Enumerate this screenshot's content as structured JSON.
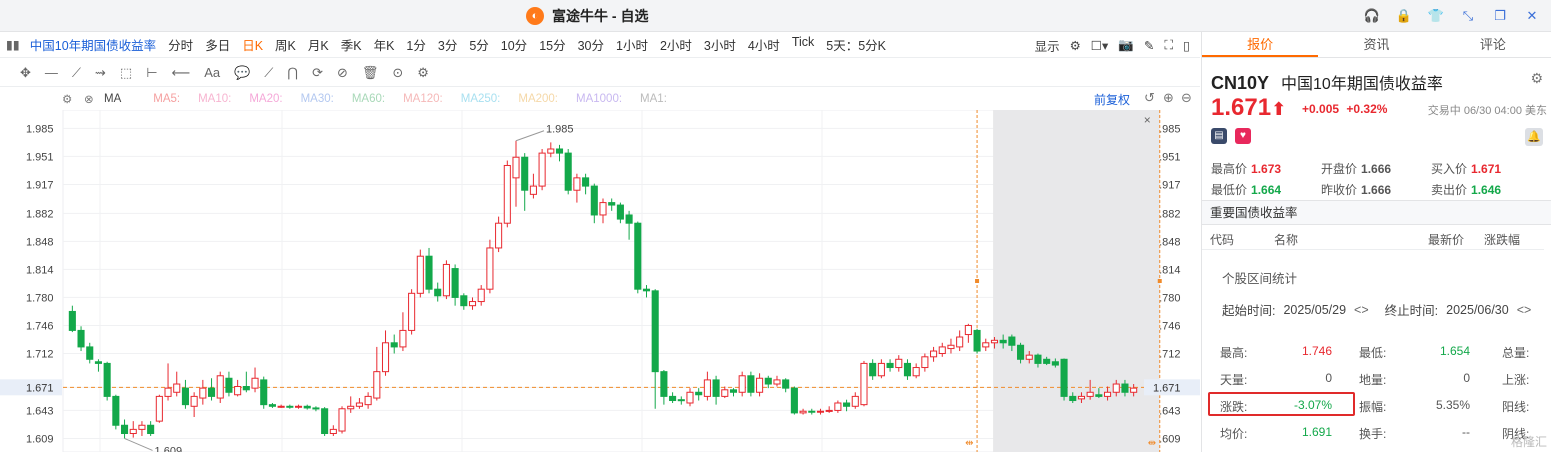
{
  "window": {
    "title": "富途牛牛 - 自选",
    "logo_glyph": "◐"
  },
  "window_icons": [
    "headset-icon",
    "lock-icon",
    "shirt-icon",
    "shrink-icon",
    "restore-icon",
    "close-icon"
  ],
  "toolbar": {
    "stock_name": "中国10年期国债收益率",
    "periods": [
      "分时",
      "多日",
      "日K",
      "周K",
      "月K",
      "季K",
      "年K",
      "1分",
      "3分",
      "5分",
      "10分",
      "15分",
      "30分",
      "1小时",
      "2小时",
      "3小时",
      "4小时",
      "Tick",
      "5天：5分K"
    ],
    "active_period": "日K",
    "display_label": "显示"
  },
  "drawing_tools": [
    "✥",
    "—",
    "⟋",
    "⇝",
    "⬚",
    "⊢",
    "⟵",
    "Aa",
    "💬",
    "⟋",
    "⋂",
    "⟳",
    "⊘",
    "🗑",
    "⊙",
    "⚙"
  ],
  "ma": {
    "label": "MA",
    "items": [
      {
        "name": "MA5:",
        "color": "#f5a0a0"
      },
      {
        "name": "MA10:",
        "color": "#f7b4d0"
      },
      {
        "name": "MA20:",
        "color": "#f5a8d8"
      },
      {
        "name": "MA30:",
        "color": "#b3c8f0"
      },
      {
        "name": "MA60:",
        "color": "#a8d8b8"
      },
      {
        "name": "MA120:",
        "color": "#f5b8b8"
      },
      {
        "name": "MA250:",
        "color": "#a8e0f0"
      },
      {
        "name": "MA200:",
        "color": "#f5d8a8"
      },
      {
        "name": "MA1000:",
        "color": "#c8b8f0"
      },
      {
        "name": "MA1:",
        "color": "#bbbbbb"
      }
    ],
    "restore_label": "前复权"
  },
  "chart_data": {
    "type": "candlestick",
    "y_ticks": [
      "1.985",
      "1.951",
      "1.917",
      "1.882",
      "1.848",
      "1.814",
      "1.780",
      "1.746",
      "1.712",
      "1.671",
      "1.643",
      "1.609"
    ],
    "ylim": [
      1.595,
      2.0
    ],
    "current_price": "1.671",
    "high_label": "1.985",
    "low_label": "1.609",
    "candles": [
      [
        1.763,
        1.74,
        1.77,
        1.738
      ],
      [
        1.74,
        1.72,
        1.745,
        1.715
      ],
      [
        1.72,
        1.705,
        1.725,
        1.7
      ],
      [
        1.702,
        1.7,
        1.705,
        1.69
      ],
      [
        1.7,
        1.66,
        1.702,
        1.655
      ],
      [
        1.66,
        1.625,
        1.662,
        1.62
      ],
      [
        1.625,
        1.615,
        1.632,
        1.609
      ],
      [
        1.615,
        1.62,
        1.63,
        1.61
      ],
      [
        1.62,
        1.625,
        1.63,
        1.612
      ],
      [
        1.625,
        1.615,
        1.63,
        1.612
      ],
      [
        1.63,
        1.66,
        1.662,
        1.628
      ],
      [
        1.66,
        1.67,
        1.7,
        1.655
      ],
      [
        1.665,
        1.675,
        1.69,
        1.66
      ],
      [
        1.67,
        1.65,
        1.68,
        1.645
      ],
      [
        1.648,
        1.66,
        1.665,
        1.635
      ],
      [
        1.658,
        1.67,
        1.68,
        1.65
      ],
      [
        1.67,
        1.66,
        1.682,
        1.655
      ],
      [
        1.658,
        1.685,
        1.69,
        1.652
      ],
      [
        1.682,
        1.665,
        1.69,
        1.66
      ],
      [
        1.662,
        1.672,
        1.68,
        1.66
      ],
      [
        1.672,
        1.668,
        1.69,
        1.665
      ],
      [
        1.67,
        1.682,
        1.695,
        1.665
      ],
      [
        1.68,
        1.65,
        1.684,
        1.645
      ],
      [
        1.65,
        1.648,
        1.652,
        1.646
      ],
      [
        1.648,
        1.648,
        1.65,
        1.646
      ],
      [
        1.648,
        1.647,
        1.65,
        1.645
      ],
      [
        1.647,
        1.648,
        1.65,
        1.645
      ],
      [
        1.648,
        1.646,
        1.65,
        1.644
      ],
      [
        1.646,
        1.645,
        1.648,
        1.642
      ],
      [
        1.645,
        1.615,
        1.647,
        1.612
      ],
      [
        1.615,
        1.62,
        1.625,
        1.612
      ],
      [
        1.618,
        1.645,
        1.648,
        1.615
      ],
      [
        1.645,
        1.648,
        1.66,
        1.64
      ],
      [
        1.648,
        1.652,
        1.658,
        1.645
      ],
      [
        1.65,
        1.66,
        1.665,
        1.645
      ],
      [
        1.658,
        1.69,
        1.72,
        1.655
      ],
      [
        1.69,
        1.725,
        1.74,
        1.685
      ],
      [
        1.725,
        1.72,
        1.735,
        1.712
      ],
      [
        1.72,
        1.74,
        1.762,
        1.715
      ],
      [
        1.74,
        1.785,
        1.79,
        1.735
      ],
      [
        1.785,
        1.83,
        1.838,
        1.78
      ],
      [
        1.83,
        1.79,
        1.84,
        1.785
      ],
      [
        1.79,
        1.782,
        1.798,
        1.775
      ],
      [
        1.782,
        1.82,
        1.825,
        1.778
      ],
      [
        1.815,
        1.78,
        1.82,
        1.77
      ],
      [
        1.782,
        1.77,
        1.785,
        1.765
      ],
      [
        1.77,
        1.775,
        1.78,
        1.765
      ],
      [
        1.775,
        1.79,
        1.795,
        1.77
      ],
      [
        1.79,
        1.84,
        1.85,
        1.785
      ],
      [
        1.84,
        1.87,
        1.878,
        1.835
      ],
      [
        1.87,
        1.94,
        1.946,
        1.865
      ],
      [
        1.925,
        1.95,
        1.97,
        1.89
      ],
      [
        1.95,
        1.91,
        1.955,
        1.885
      ],
      [
        1.905,
        1.915,
        1.93,
        1.9
      ],
      [
        1.915,
        1.955,
        1.96,
        1.91
      ],
      [
        1.955,
        1.96,
        1.968,
        1.95
      ],
      [
        1.96,
        1.955,
        1.965,
        1.945
      ],
      [
        1.955,
        1.91,
        1.96,
        1.905
      ],
      [
        1.91,
        1.925,
        1.93,
        1.895
      ],
      [
        1.925,
        1.915,
        1.93,
        1.905
      ],
      [
        1.915,
        1.88,
        1.918,
        1.87
      ],
      [
        1.88,
        1.895,
        1.9,
        1.87
      ],
      [
        1.895,
        1.892,
        1.9,
        1.885
      ],
      [
        1.892,
        1.875,
        1.895,
        1.87
      ],
      [
        1.88,
        1.87,
        1.885,
        1.85
      ],
      [
        1.87,
        1.79,
        1.872,
        1.785
      ],
      [
        1.79,
        1.788,
        1.795,
        1.78
      ],
      [
        1.788,
        1.69,
        1.79,
        1.645
      ],
      [
        1.69,
        1.66,
        1.692,
        1.65
      ],
      [
        1.66,
        1.655,
        1.665,
        1.652
      ],
      [
        1.656,
        1.655,
        1.66,
        1.65
      ],
      [
        1.652,
        1.665,
        1.67,
        1.648
      ],
      [
        1.665,
        1.662,
        1.67,
        1.655
      ],
      [
        1.66,
        1.68,
        1.69,
        1.655
      ],
      [
        1.68,
        1.66,
        1.685,
        1.65
      ],
      [
        1.66,
        1.668,
        1.672,
        1.658
      ],
      [
        1.668,
        1.665,
        1.67,
        1.66
      ],
      [
        1.665,
        1.685,
        1.69,
        1.66
      ],
      [
        1.685,
        1.665,
        1.69,
        1.66
      ],
      [
        1.665,
        1.682,
        1.688,
        1.66
      ],
      [
        1.682,
        1.675,
        1.685,
        1.67
      ],
      [
        1.675,
        1.68,
        1.685,
        1.672
      ],
      [
        1.68,
        1.67,
        1.682,
        1.665
      ],
      [
        1.67,
        1.64,
        1.672,
        1.638
      ],
      [
        1.64,
        1.642,
        1.645,
        1.638
      ],
      [
        1.642,
        1.641,
        1.645,
        1.638
      ],
      [
        1.641,
        1.642,
        1.645,
        1.638
      ],
      [
        1.642,
        1.643,
        1.648,
        1.64
      ],
      [
        1.643,
        1.652,
        1.655,
        1.64
      ],
      [
        1.652,
        1.648,
        1.656,
        1.642
      ],
      [
        1.648,
        1.66,
        1.665,
        1.645
      ],
      [
        1.65,
        1.7,
        1.703,
        1.648
      ],
      [
        1.7,
        1.685,
        1.705,
        1.68
      ],
      [
        1.685,
        1.7,
        1.705,
        1.682
      ],
      [
        1.7,
        1.695,
        1.705,
        1.69
      ],
      [
        1.695,
        1.705,
        1.71,
        1.69
      ],
      [
        1.7,
        1.685,
        1.705,
        1.68
      ],
      [
        1.685,
        1.695,
        1.7,
        1.682
      ],
      [
        1.695,
        1.708,
        1.712,
        1.69
      ],
      [
        1.708,
        1.715,
        1.72,
        1.702
      ],
      [
        1.712,
        1.72,
        1.725,
        1.708
      ],
      [
        1.718,
        1.722,
        1.73,
        1.712
      ],
      [
        1.72,
        1.732,
        1.74,
        1.715
      ],
      [
        1.735,
        1.746,
        1.748,
        1.725
      ],
      [
        1.74,
        1.715,
        1.742,
        1.712
      ],
      [
        1.72,
        1.725,
        1.73,
        1.715
      ],
      [
        1.725,
        1.728,
        1.732,
        1.718
      ],
      [
        1.728,
        1.725,
        1.735,
        1.718
      ],
      [
        1.732,
        1.722,
        1.735,
        1.715
      ],
      [
        1.722,
        1.705,
        1.725,
        1.7
      ],
      [
        1.705,
        1.71,
        1.715,
        1.7
      ],
      [
        1.71,
        1.7,
        1.712,
        1.695
      ],
      [
        1.705,
        1.7,
        1.708,
        1.698
      ],
      [
        1.702,
        1.698,
        1.706,
        1.695
      ],
      [
        1.705,
        1.66,
        1.706,
        1.655
      ],
      [
        1.66,
        1.655,
        1.665,
        1.652
      ],
      [
        1.657,
        1.66,
        1.665,
        1.652
      ],
      [
        1.66,
        1.665,
        1.68,
        1.656
      ],
      [
        1.662,
        1.66,
        1.67,
        1.658
      ],
      [
        1.66,
        1.665,
        1.672,
        1.655
      ],
      [
        1.665,
        1.675,
        1.68,
        1.66
      ],
      [
        1.675,
        1.665,
        1.68,
        1.66
      ],
      [
        1.665,
        1.67,
        1.675,
        1.66
      ]
    ],
    "selection": {
      "start_index": 104,
      "end_index": 125
    }
  },
  "right_panel": {
    "tabs": [
      "报价",
      "资讯",
      "评论"
    ],
    "code": "CN10Y",
    "name": "中国10年期国债收益率",
    "price": "1.671",
    "change": "+0.005",
    "change_pct": "+0.32%",
    "trade_time": "交易中 06/30 04:00 美东",
    "quotes": [
      {
        "label": "最高价",
        "value": "1.673",
        "color": "up"
      },
      {
        "label": "开盘价",
        "value": "1.666",
        "color": "gray"
      },
      {
        "label": "买入价",
        "value": "1.671",
        "color": "up"
      },
      {
        "label": "最低价",
        "value": "1.664",
        "color": "down"
      },
      {
        "label": "昨收价",
        "value": "1.666",
        "color": "gray"
      },
      {
        "label": "卖出价",
        "value": "1.646",
        "color": "down"
      }
    ],
    "section_title": "重要国债收益率",
    "list_headers": [
      "代码",
      "名称",
      "最新价",
      "涨跌幅"
    ],
    "stat_title": "个股区间统计",
    "start_label": "起始时间:",
    "start_date": "2025/05/29",
    "end_label": "终止时间:",
    "end_date": "2025/06/30",
    "stats": [
      {
        "l1": "最高:",
        "v1": "1.746",
        "c1": "up",
        "l2": "最低:",
        "v2": "1.654",
        "c2": "down",
        "l3": "总量:"
      },
      {
        "l1": "天量:",
        "v1": "0",
        "c1": "gray",
        "l2": "地量:",
        "v2": "0",
        "c2": "gray",
        "l3": "上涨:"
      },
      {
        "l1": "涨跌:",
        "v1": "-3.07%",
        "c1": "down",
        "l2": "振幅:",
        "v2": "5.35%",
        "c2": "gray",
        "l3": "阳线:"
      },
      {
        "l1": "均价:",
        "v1": "1.691",
        "c1": "down",
        "l2": "换手:",
        "v2": "--",
        "c2": "gray",
        "l3": "阴线:"
      }
    ],
    "watermark": "格隆汇"
  }
}
